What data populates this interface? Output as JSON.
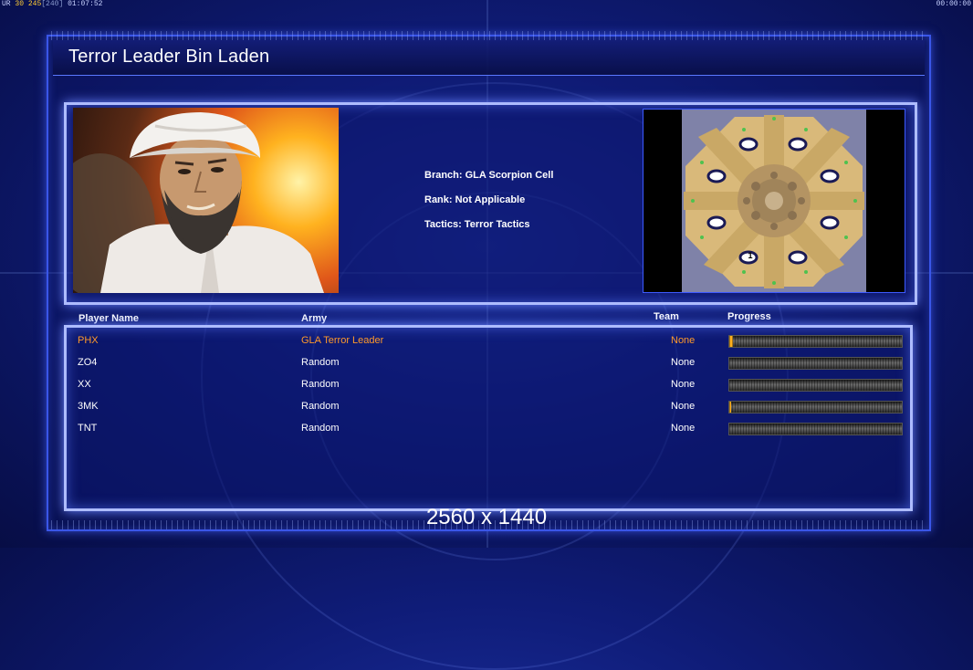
{
  "hud": {
    "left_code": "UR",
    "left_values": [
      "30",
      "245",
      "[240]"
    ],
    "left_time": "01:07:52",
    "right_time": "00:00:00"
  },
  "title": "Terror Leader Bin Laden",
  "general": {
    "branch": "Branch: GLA Scorpion Cell",
    "rank": "Rank: Not Applicable",
    "tactics": "Tactics: Terror Tactics"
  },
  "minimap": {
    "start_marker_label": "1"
  },
  "table": {
    "headers": {
      "player": "Player Name",
      "army": "Army",
      "team": "Team",
      "progress": "Progress"
    },
    "rows": [
      {
        "player": "PHX",
        "army": "GLA Terror Leader",
        "team": "None",
        "progress": 0.02,
        "active": true
      },
      {
        "player": "ZO4",
        "army": "Random",
        "team": "None",
        "progress": 0.0,
        "active": false
      },
      {
        "player": "XX",
        "army": "Random",
        "team": "None",
        "progress": 0.0,
        "active": false
      },
      {
        "player": "3MK",
        "army": "Random",
        "team": "None",
        "progress": 0.01,
        "active": false
      },
      {
        "player": "TNT",
        "army": "Random",
        "team": "None",
        "progress": 0.0,
        "active": false
      }
    ]
  },
  "resolution_text": "2560 x 1440",
  "colors": {
    "accent": "#ff9a2a",
    "frame": "#aebcff",
    "progress": "#ffb020"
  }
}
